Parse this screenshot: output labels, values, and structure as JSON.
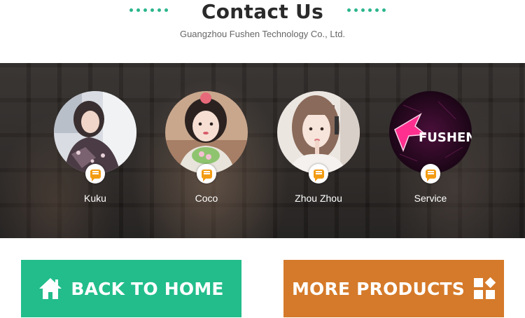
{
  "header": {
    "title": "Contact Us",
    "subtitle": "Guangzhou Fushen Technology Co., Ltd."
  },
  "contacts": [
    {
      "name": "Kuku"
    },
    {
      "name": "Coco"
    },
    {
      "name": "Zhou Zhou"
    },
    {
      "name": "Service",
      "logo_text": "FUSHEN"
    }
  ],
  "buttons": {
    "home_label": "BACK TO HOME",
    "more_label": "MORE PRODUCTS"
  },
  "colors": {
    "accent_green": "#22bd8b",
    "accent_orange": "#d57a2a",
    "chat_icon": "#f39c12",
    "logo_pink": "#ff2f8f"
  },
  "icons": {
    "home": "home-icon",
    "more": "grid-blocks-icon",
    "chat": "chat-bubble-icon"
  }
}
